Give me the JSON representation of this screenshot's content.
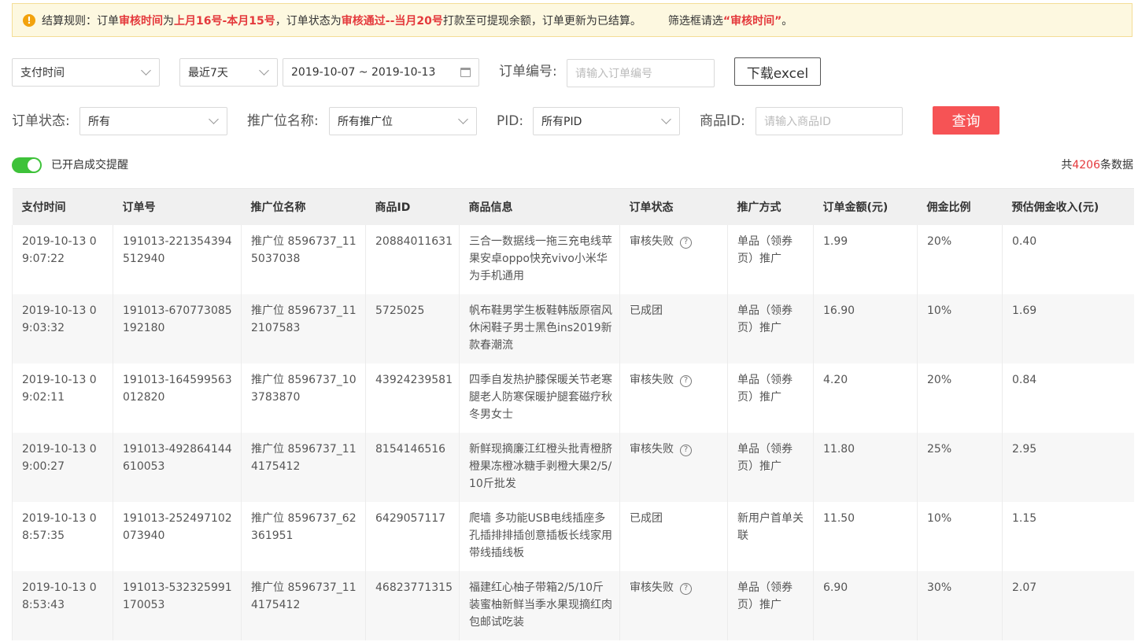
{
  "notice": {
    "parts": [
      {
        "text": "结算规则：订单",
        "red": false
      },
      {
        "text": "审核时间",
        "red": true
      },
      {
        "text": "为",
        "red": false
      },
      {
        "text": "上月16号-本月15号",
        "red": true
      },
      {
        "text": "，订单状态为",
        "red": false
      },
      {
        "text": "审核通过--当月20号",
        "red": true
      },
      {
        "text": "打款至可提现余额，订单更新为已结算。",
        "red": false
      }
    ],
    "hint_prefix": "筛选框请选",
    "hint_highlight": "“审核时间”",
    "hint_suffix": "。"
  },
  "filters": {
    "time_type": "支付时间",
    "range_preset": "最近7天",
    "date_range": "2019-10-07 ~ 2019-10-13",
    "order_no_label": "订单编号:",
    "order_no_placeholder": "请输入订单编号",
    "download_label": "下载excel",
    "status_label": "订单状态:",
    "status_value": "所有",
    "position_label": "推广位名称:",
    "position_value": "所有推广位",
    "pid_label": "PID:",
    "pid_value": "所有PID",
    "goods_id_label": "商品ID:",
    "goods_id_placeholder": "请输入商品ID",
    "query_label": "查询"
  },
  "reminder": {
    "label": "已开启成交提醒",
    "enabled": true
  },
  "total": {
    "prefix": "共",
    "count": "4206",
    "suffix": "条数据"
  },
  "table": {
    "headers": [
      "支付时间",
      "订单号",
      "推广位名称",
      "商品ID",
      "商品信息",
      "订单状态",
      "推广方式",
      "订单金额(元)",
      "佣金比例",
      "预估佣金收入(元)"
    ],
    "rows": [
      {
        "time": "2019-10-13 09:07:22",
        "order": "191013-221354394512940",
        "position": "推广位 8596737_115037038",
        "goods_id": "20884011631",
        "info": "三合一数据线一拖三充电线苹果安卓oppo快充vivo小米华为手机通用",
        "status": "审核失败",
        "status_help": true,
        "method": "单品（领券页）推广",
        "amount": "1.99",
        "rate": "20%",
        "income": "0.40"
      },
      {
        "time": "2019-10-13 09:03:32",
        "order": "191013-670773085192180",
        "position": "推广位 8596737_112107583",
        "goods_id": "5725025",
        "info": "帆布鞋男学生板鞋韩版原宿风休闲鞋子男士黑色ins2019新款春潮流",
        "status": "已成团",
        "status_help": false,
        "method": "单品（领券页）推广",
        "amount": "16.90",
        "rate": "10%",
        "income": "1.69"
      },
      {
        "time": "2019-10-13 09:02:11",
        "order": "191013-164599563012820",
        "position": "推广位 8596737_103783870",
        "goods_id": "43924239581",
        "info": "四季自发热护膝保暖关节老寒腿老人防寒保暖护腿套磁疗秋冬男女士",
        "status": "审核失败",
        "status_help": true,
        "method": "单品（领券页）推广",
        "amount": "4.20",
        "rate": "20%",
        "income": "0.84"
      },
      {
        "time": "2019-10-13 09:00:27",
        "order": "191013-492864144610053",
        "position": "推广位 8596737_114175412",
        "goods_id": "8154146516",
        "info": "新鲜现摘廉江红橙头批青橙脐橙果冻橙冰糖手剥橙大果2/5/10斤批发",
        "status": "审核失败",
        "status_help": true,
        "method": "单品（领券页）推广",
        "amount": "11.80",
        "rate": "25%",
        "income": "2.95"
      },
      {
        "time": "2019-10-13 08:57:35",
        "order": "191013-252497102073940",
        "position": "推广位 8596737_62361951",
        "goods_id": "6429057117",
        "info": "爬墙 多功能USB电线插座多孔插排排插创意插板长线家用带线插线板",
        "status": "已成团",
        "status_help": false,
        "method": "新用户首单关联",
        "amount": "11.50",
        "rate": "10%",
        "income": "1.15"
      },
      {
        "time": "2019-10-13 08:53:43",
        "order": "191013-532325991170053",
        "position": "推广位 8596737_114175412",
        "goods_id": "46823771315",
        "info": "福建红心柚子带箱2/5/10斤装蜜柚新鲜当季水果现摘红肉包邮试吃装",
        "status": "审核失败",
        "status_help": true,
        "method": "单品（领券页）推广",
        "amount": "6.90",
        "rate": "30%",
        "income": "2.07"
      }
    ]
  },
  "colors": {
    "accent_red": "#e4393c",
    "query_button": "#f65355",
    "toggle_on": "#3ec23a",
    "notice_bg": "#fdf8e0"
  }
}
